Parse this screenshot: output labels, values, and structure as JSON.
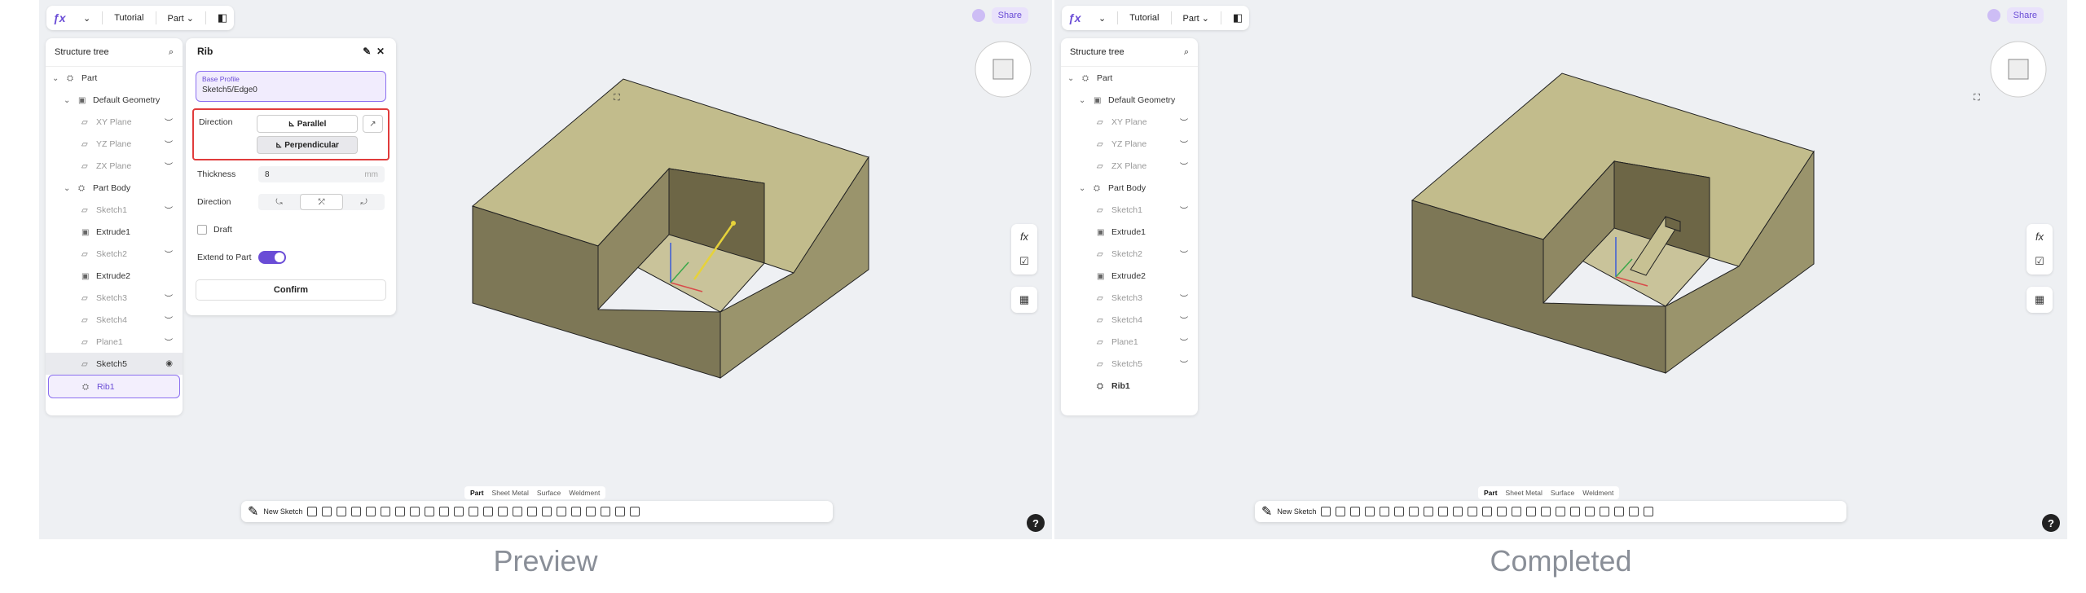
{
  "topbar": {
    "tutorial": "Tutorial",
    "part": "Part",
    "share": "Share"
  },
  "tree": {
    "title": "Structure tree",
    "items": [
      {
        "label": "Part"
      },
      {
        "label": "Default Geometry"
      },
      {
        "label": "XY Plane"
      },
      {
        "label": "YZ Plane"
      },
      {
        "label": "ZX Plane"
      },
      {
        "label": "Part Body"
      },
      {
        "label": "Sketch1"
      },
      {
        "label": "Extrude1"
      },
      {
        "label": "Sketch2"
      },
      {
        "label": "Extrude2"
      },
      {
        "label": "Sketch3"
      },
      {
        "label": "Sketch4"
      },
      {
        "label": "Plane1"
      },
      {
        "label": "Sketch5"
      },
      {
        "label": "Rib1"
      }
    ]
  },
  "rib": {
    "title": "Rib",
    "base_label": "Base Profile",
    "base_value": "Sketch5/Edge0",
    "direction_label": "Direction",
    "parallel": "Parallel",
    "perpendicular": "Perpendicular",
    "thickness_label": "Thickness",
    "thickness_value": "8",
    "thickness_unit": "mm",
    "direction2_label": "Direction",
    "draft": "Draft",
    "extend": "Extend to Part",
    "confirm": "Confirm"
  },
  "modes": [
    "Part",
    "Sheet Metal",
    "Surface",
    "Weldment"
  ],
  "toolbar": {
    "new_sketch": "New Sketch"
  },
  "captions": {
    "left": "Preview",
    "right": "Completed"
  },
  "colors": {
    "accent": "#6a4cd6",
    "highlight_border": "#e03c3c",
    "model_top": "#c9c297",
    "model_side": "#8a8260"
  }
}
